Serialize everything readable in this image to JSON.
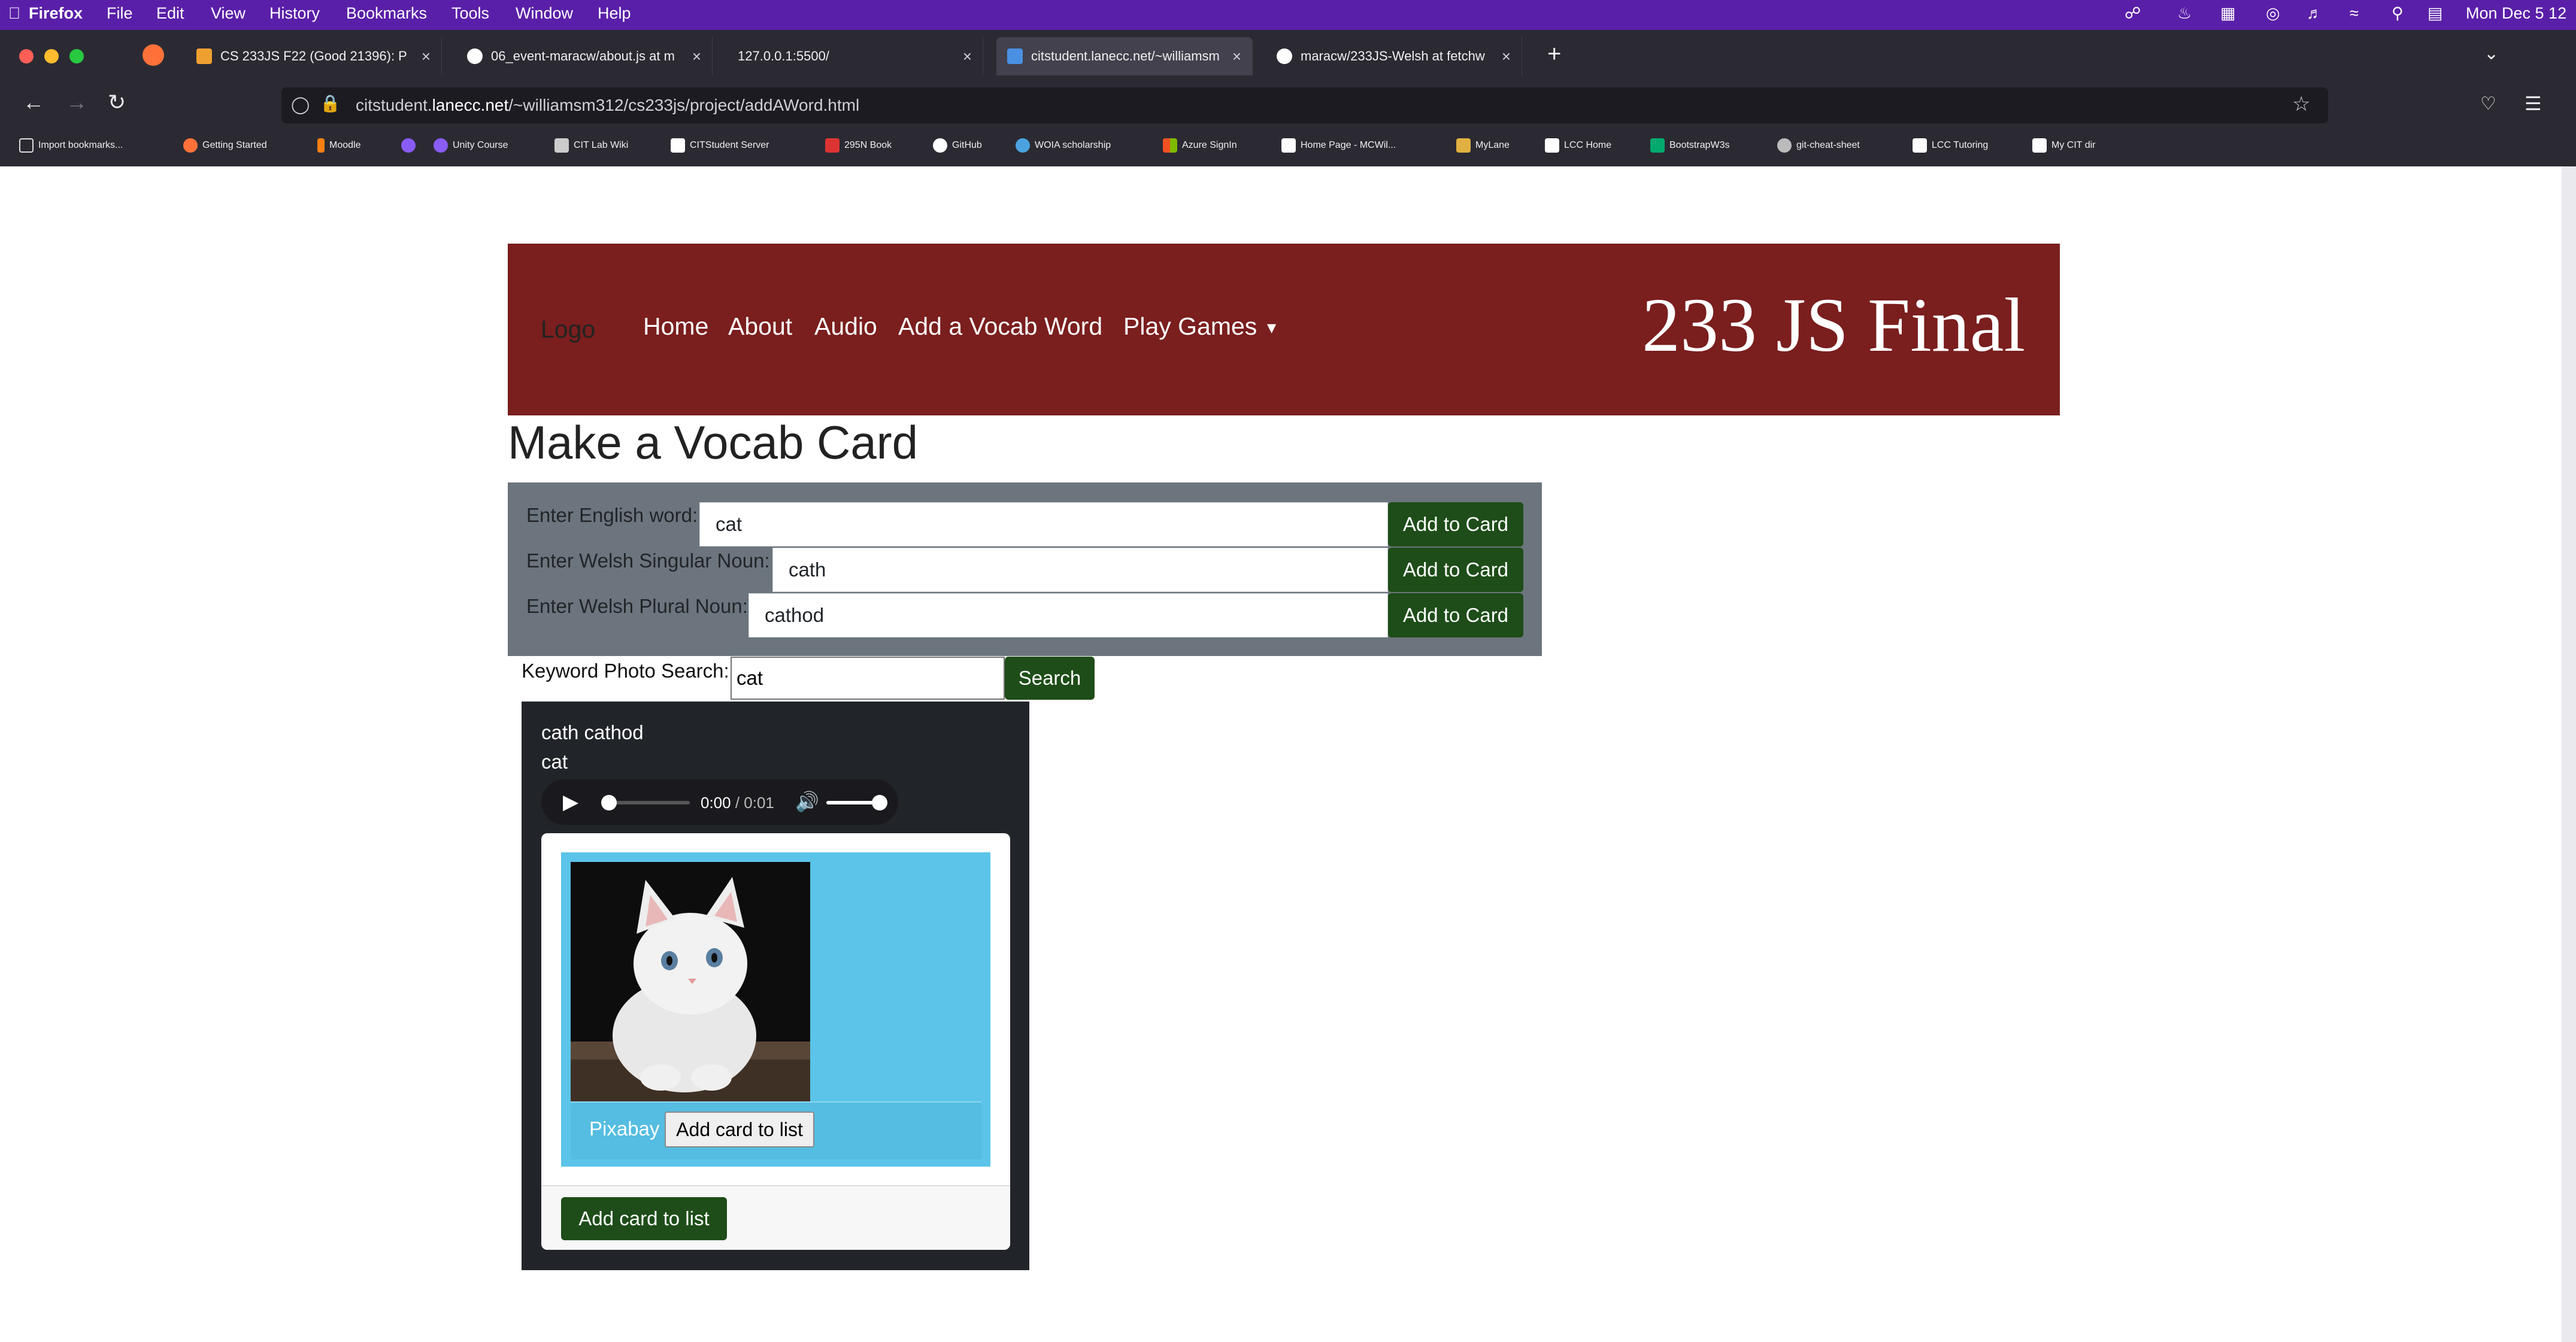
{
  "menubar": {
    "app": "Firefox",
    "items": [
      "File",
      "Edit",
      "View",
      "History",
      "Bookmarks",
      "Tools",
      "Window",
      "Help"
    ],
    "clock": "Mon Dec 5  12"
  },
  "tabs": [
    {
      "title": "CS 233JS F22 (Good 21396): P",
      "favicon_color": "#f0a030"
    },
    {
      "title": "06_event-maracw/about.js at m",
      "favicon_color": "#ffffff"
    },
    {
      "title": "127.0.0.1:5500/",
      "favicon_color": ""
    },
    {
      "title": "citstudent.lanecc.net/~williamsm",
      "favicon_color": "#4a90e2"
    },
    {
      "title": "maracw/233JS-Welsh at fetchw",
      "favicon_color": "#ffffff"
    }
  ],
  "new_tab_label": "+",
  "address_bar": {
    "url_host": "citstudent.",
    "url_domain": "lanecc.net",
    "url_path": "/~williamsm312/cs233js/project/addAWord.html"
  },
  "bookmarks": [
    {
      "label": "Import bookmarks...",
      "color": "#dddddd"
    },
    {
      "label": "Getting Started",
      "color": "#ff7139"
    },
    {
      "label": "Moodle",
      "color": "#f98012"
    },
    {
      "label": "",
      "color": "#8a5cf5"
    },
    {
      "label": "Unity Course",
      "color": "#8a5cf5"
    },
    {
      "label": "CIT Lab Wiki",
      "color": "#cccccc"
    },
    {
      "label": "CITStudent Server",
      "color": "#ffffff"
    },
    {
      "label": "295N Book",
      "color": "#d33"
    },
    {
      "label": "GitHub",
      "color": "#ffffff"
    },
    {
      "label": "WOIA scholarship",
      "color": "#4aa3df"
    },
    {
      "label": "Azure SignIn",
      "color": "#f25022"
    },
    {
      "label": "Home Page - MCWil...",
      "color": "#ffffff"
    },
    {
      "label": "MyLane",
      "color": "#e0b040"
    },
    {
      "label": "LCC Home",
      "color": "#ffffff"
    },
    {
      "label": "BootstrapW3s",
      "color": "#04aa6d"
    },
    {
      "label": "git-cheat-sheet",
      "color": "#bbbbbb"
    },
    {
      "label": "LCC Tutoring",
      "color": "#ffffff"
    },
    {
      "label": "My CIT dir",
      "color": "#ffffff"
    }
  ],
  "site": {
    "logo": "Logo",
    "nav": [
      "Home",
      "About",
      "Audio",
      "Add a Vocab Word",
      "Play Games"
    ],
    "title": "233 JS Final"
  },
  "page_title": "Make a Vocab Card",
  "form": {
    "english_label": "Enter English word:",
    "english_value": "cat",
    "singular_label": "Enter Welsh Singular Noun:",
    "singular_value": "cath",
    "plural_label": "Enter Welsh Plural Noun:",
    "plural_value": "cathod",
    "add_to_card": "Add to Card"
  },
  "photo_search": {
    "label": "Keyword Photo Search:",
    "value": "cat",
    "button": "Search"
  },
  "card": {
    "welsh_words": "cath cathod",
    "english": "cat",
    "audio_time": "0:00",
    "audio_duration": "/ 0:01",
    "photo_source": "Pixabay",
    "add_card_to_list_small": "Add card to list",
    "add_card_to_list": "Add card to list"
  }
}
